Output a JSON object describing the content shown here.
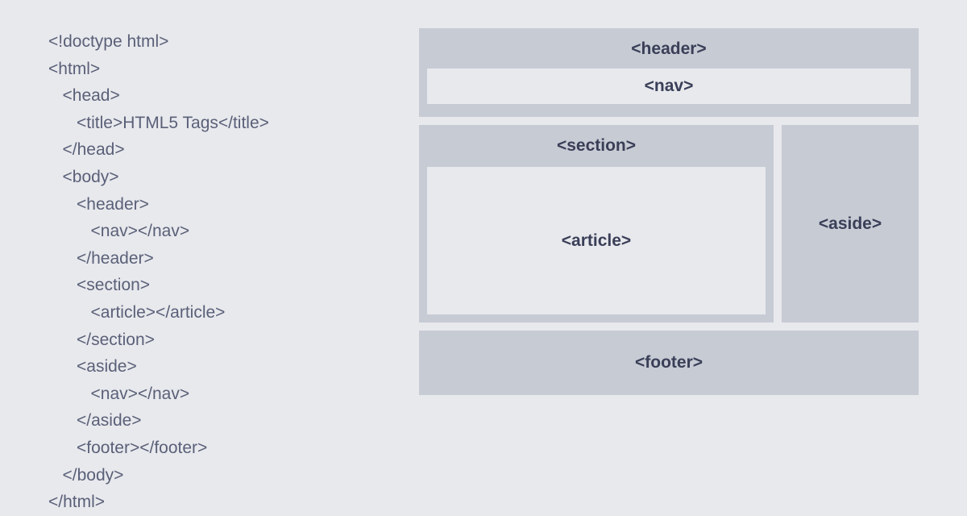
{
  "code": {
    "lines": [
      {
        "indent": 0,
        "text": "<!doctype html>"
      },
      {
        "indent": 0,
        "text": "<html>"
      },
      {
        "indent": 1,
        "text": "<head>"
      },
      {
        "indent": 2,
        "text": "<title>HTML5 Tags</title>"
      },
      {
        "indent": 1,
        "text": "</head>"
      },
      {
        "indent": 1,
        "text": "<body>"
      },
      {
        "indent": 2,
        "text": "<header>"
      },
      {
        "indent": 3,
        "text": "<nav></nav>"
      },
      {
        "indent": 2,
        "text": "</header>"
      },
      {
        "indent": 2,
        "text": "<section>"
      },
      {
        "indent": 3,
        "text": "<article></article>"
      },
      {
        "indent": 2,
        "text": "</section>"
      },
      {
        "indent": 2,
        "text": "<aside>"
      },
      {
        "indent": 3,
        "text": "<nav></nav>"
      },
      {
        "indent": 2,
        "text": "</aside>"
      },
      {
        "indent": 2,
        "text": "<footer></footer>"
      },
      {
        "indent": 1,
        "text": "</body>"
      },
      {
        "indent": 0,
        "text": "</html>"
      }
    ]
  },
  "layout": {
    "header": "<header>",
    "nav": "<nav>",
    "section": "<section>",
    "article": "<article>",
    "aside": "<aside>",
    "footer": "<footer>"
  }
}
